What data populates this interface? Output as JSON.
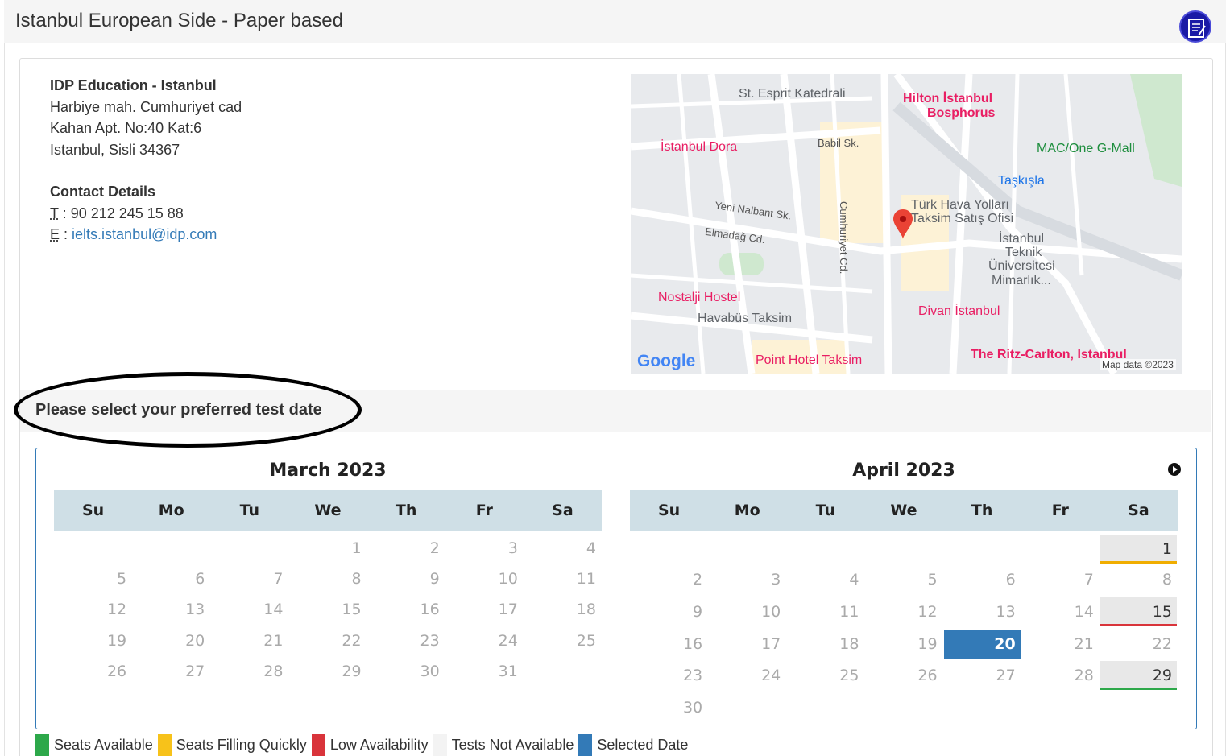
{
  "header": {
    "title": "Istanbul European Side - Paper based",
    "icon": "notepad-icon"
  },
  "venue": {
    "name": "IDP Education - Istanbul",
    "address_lines": [
      "Harbiye mah. Cumhuriyet cad",
      "Kahan Apt. No:40 Kat:6",
      "Istanbul, Sisli 34367"
    ],
    "contact_heading": "Contact Details",
    "phone_label": "T",
    "phone": "90 212 245 15 88",
    "email_label": "E",
    "email": "ielts.istanbul@idp.com"
  },
  "map": {
    "labels": {
      "esprit": "St. Esprit Katedrali",
      "hilton": "Hilton İstanbul",
      "hilton2": "Bosphorus",
      "dora": "İstanbul Dora",
      "babil": "Babil Sk.",
      "macone": "MAC/One G-Mall",
      "taskisla": "Taşkışla",
      "thy1": "Türk Hava Yolları",
      "thy2": "Taksim Satış Ofisi",
      "cumhuriyet": "Cumhuriyet Cd.",
      "nalbant": "Yeni Nalbant Sk.",
      "elmadag": "Elmadağ Cd.",
      "itu1": "İstanbul",
      "itu2": "Teknik",
      "itu3": "Üniversitesi",
      "itu4": "Mimarlık...",
      "nostalji": "Nostalji Hostel",
      "divan": "Divan İstanbul",
      "havabus": "Havabüs Taksim",
      "point": "Point Hotel Taksim",
      "ritz": "The Ritz-Carlton, Istanbul",
      "google": "Google",
      "mapdata": "Map data ©2023"
    }
  },
  "prompt": "Please select your preferred test date",
  "calendar": {
    "next_icon": "next-month-icon",
    "weekdays": [
      "Su",
      "Mo",
      "Tu",
      "We",
      "Th",
      "Fr",
      "Sa"
    ],
    "months": [
      {
        "title": "March 2023",
        "weeks": [
          [
            "",
            "",
            "",
            "1",
            "2",
            "3",
            "4"
          ],
          [
            "5",
            "6",
            "7",
            "8",
            "9",
            "10",
            "11"
          ],
          [
            "12",
            "13",
            "14",
            "15",
            "16",
            "17",
            "18"
          ],
          [
            "19",
            "20",
            "21",
            "22",
            "23",
            "24",
            "25"
          ],
          [
            "26",
            "27",
            "28",
            "29",
            "30",
            "31",
            ""
          ]
        ]
      },
      {
        "title": "April 2023",
        "weeks": [
          [
            "",
            "",
            "",
            "",
            "",
            "",
            "1"
          ],
          [
            "2",
            "3",
            "4",
            "5",
            "6",
            "7",
            "8"
          ],
          [
            "9",
            "10",
            "11",
            "12",
            "13",
            "14",
            "15"
          ],
          [
            "16",
            "17",
            "18",
            "19",
            "20",
            "21",
            "22"
          ],
          [
            "23",
            "24",
            "25",
            "26",
            "27",
            "28",
            "29"
          ],
          [
            "30",
            "",
            "",
            "",
            "",
            "",
            ""
          ]
        ],
        "test_dates": [
          {
            "day": "1",
            "status": "filling",
            "color": "#f0ad00"
          },
          {
            "day": "15",
            "status": "low",
            "color": "#d9343b"
          },
          {
            "day": "29",
            "status": "available",
            "color": "#2da84a"
          }
        ],
        "selected": "20"
      }
    ]
  },
  "legend": [
    {
      "label": "Seats Available",
      "color": "#2da84a"
    },
    {
      "label": "Seats Filling Quickly",
      "color": "#f7c21a"
    },
    {
      "label": "Low Availability",
      "color": "#d9343b"
    },
    {
      "label": "Tests Not Available",
      "color": "#f3f3f3"
    },
    {
      "label": "Selected Date",
      "color": "#337ab7"
    }
  ]
}
